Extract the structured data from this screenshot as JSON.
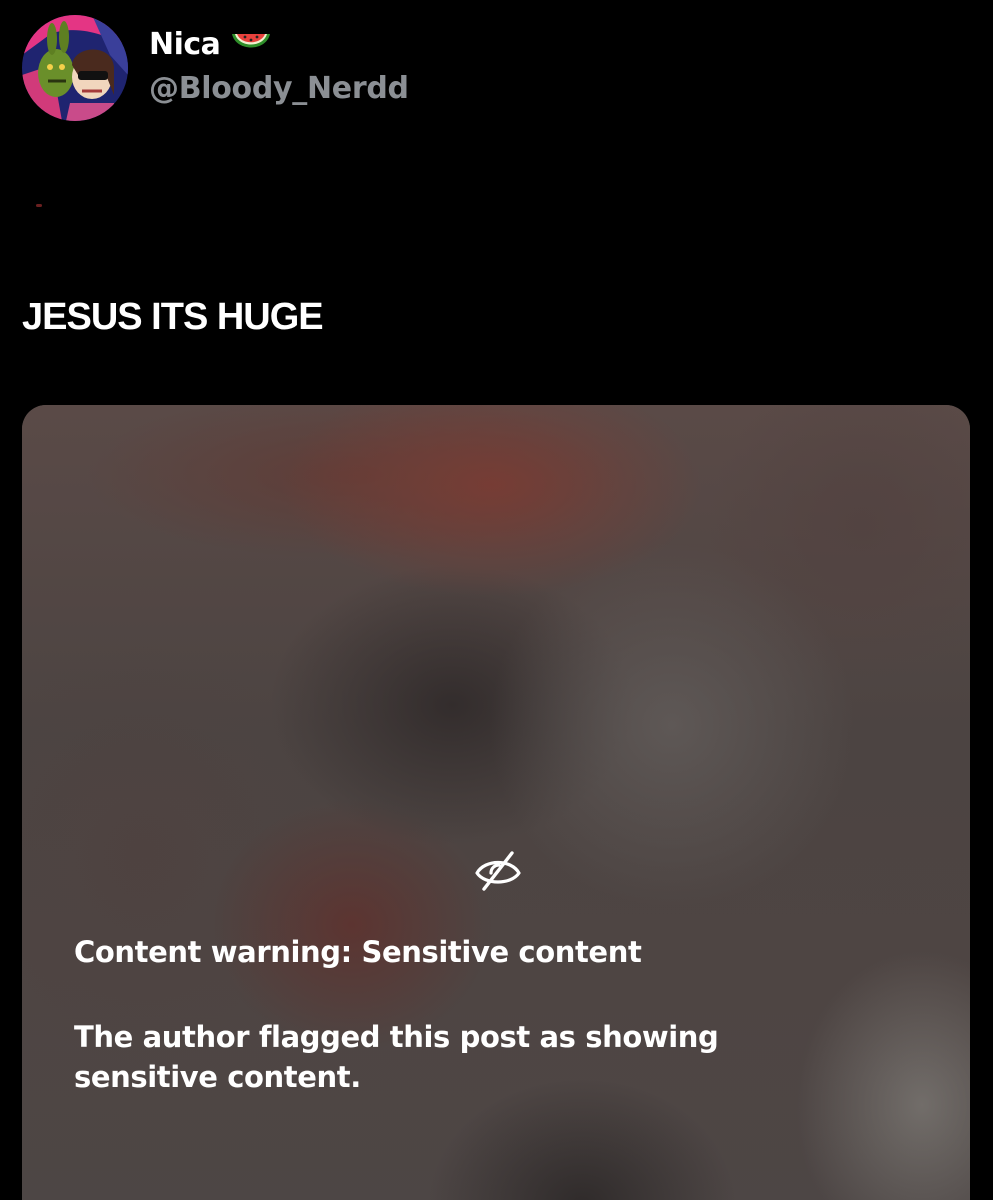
{
  "post": {
    "author": {
      "display_name": "Nica",
      "handle": "@Bloody_Nerdd",
      "emoji_icon": "watermelon-icon",
      "avatar_colors": [
        "#1a1d6e",
        "#e0338a",
        "#6b9a2e"
      ]
    },
    "text": "JESUS ITS HUGE",
    "media": {
      "warning_icon": "eye-slash-icon",
      "warning_title": "Content warning: Sensitive content",
      "warning_body": "The author flagged this post as showing sensitive content."
    }
  },
  "colors": {
    "background": "#000000",
    "handle_text": "#8b8f94",
    "primary_text": "#ffffff"
  }
}
